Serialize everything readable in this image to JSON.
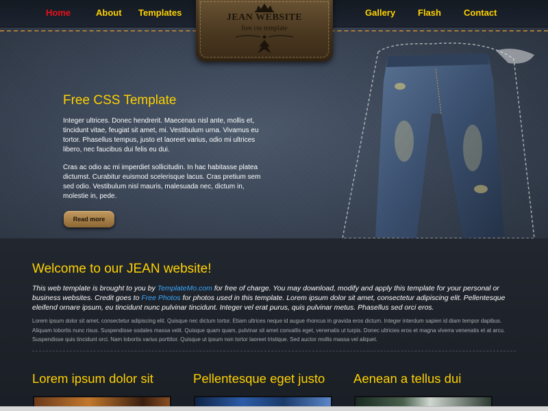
{
  "nav": {
    "items": [
      {
        "label": "Home",
        "active": true
      },
      {
        "label": "About",
        "active": false
      },
      {
        "label": "Templates",
        "active": false
      },
      {
        "label": "Gallery",
        "active": false
      },
      {
        "label": "Flash",
        "active": false
      },
      {
        "label": "Contact",
        "active": false
      }
    ]
  },
  "logo": {
    "title": "JEAN WEBSITE",
    "subtitle": "free css template",
    "crest_icon": "crown-crest-icon",
    "ornament_icon": "fleur-ornament-icon"
  },
  "hero": {
    "title": "Free CSS Template",
    "para1": "Integer ultrices. Donec hendrerit. Maecenas nisl ante, mollis et, tincidunt vitae, feugiat sit amet, mi. Vestibulum urna. Vivamus eu tortor. Phasellus tempus, justo et laoreet varius, odio mi ultrices libero, nec faucibus dui felis eu dui.",
    "para2": "Cras ac odio ac mi imperdiet sollicitudin. In hac habitasse platea dictumst. Curabitur euismod scelerisque lacus. Cras pretium sem sed odio. Vestibulum nisl mauris, malesuada nec, dictum in, molestie in, pede.",
    "button_label": "Read more"
  },
  "welcome": {
    "title": "Welcome to our JEAN website!",
    "para1_a": "This web template is brought to you by ",
    "para1_link1": "TemplateMo.com",
    "para1_b": " for free of charge. You may download, modify and apply this template for your personal or business websites. Credit goes to ",
    "para1_link2": "Free Photos",
    "para1_c": " for photos used in this template. Lorem ipsum dolor sit amet, consectetur adipiscing elit. Pellentesque eleifend ornare ipsum, eu tincidunt nunc pulvinar tincidunt. Integer vel erat purus, quis pulvinar metus. Phasellus sed orci eros.",
    "para2": "Lorem ipsum dolor sit amet, consectetur adipiscing elit. Quisque nec dictum tortor. Etiam ultrices neque id augue rhoncus in gravida eros dictum. Integer interdum sapien id diam tempor dapibus. Aliquam lobortis nunc risus. Suspendisse sodales massa velit. Quisque quam quam, pulvinar sit amet convallis eget, venenatis ut turpis. Donec ultricies eros et magna viverra venenatis et at arcu. Suspendisse quis tincidunt orci. Nam lobortis varius porttitor. Quisque ut ipsum non tortor laoreet tristique. Sed auctor mollis massa vel aliquet."
  },
  "columns": [
    {
      "title": "Lorem ipsum dolor sit"
    },
    {
      "title": "Pellentesque eget justo"
    },
    {
      "title": "Aenean a tellus dui"
    }
  ],
  "colors": {
    "accent_yellow": "#ffd200",
    "nav_active_red": "#e8111a",
    "link_blue": "#3aa9ff",
    "leather_brown": "#6d5636"
  }
}
